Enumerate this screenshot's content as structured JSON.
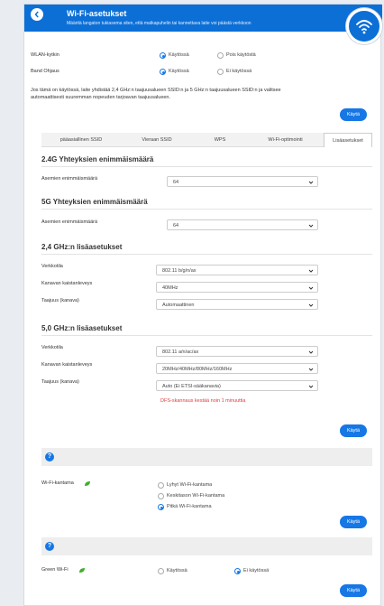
{
  "header": {
    "title": "Wi-Fi-asetukset",
    "subtitle": "Määritä langaton tukiasema siten, että matkapuhelin tai kannettava laite voi päästä verkkoon"
  },
  "wlan_switch": {
    "label": "WLAN-kytkin",
    "on": "Käytössä",
    "off": "Pois käytöstä"
  },
  "band_steering": {
    "label": "Band Ohjaus",
    "on": "Käytössä",
    "off": "Ei käytössä"
  },
  "description": [
    "Jos tämä on käytössä, laite yhdistää 2,4 GHz:n taajuusalueen SSID:n ja 5 GHz:n taajuusalueen SSID:n ja valitsee",
    "automaattisesti suuremman nopeuden tarjoavan taajuusalueen."
  ],
  "apply_label": "Käytä",
  "tabs": [
    "pääasiallinen SSID",
    "Vieraan SSID",
    "WPS",
    "Wi-Fi-optimointi",
    "Lisäasetukset"
  ],
  "max_24": {
    "title": "2.4G Yhteyksien enimmäismäärä",
    "label": "Asemien enimmäismäärä",
    "value": "64"
  },
  "max_5": {
    "title": "5G Yhteyksien enimmäismäärä",
    "label": "Asemien enimmäismäärä",
    "value": "64"
  },
  "adv_24": {
    "title": "2,4 GHz:n lisäasetukset",
    "mode_label": "Verkkotila",
    "mode_value": "802.11 b/g/n/ax",
    "bw_label": "Kanavan kaistanleveys",
    "bw_value": "40MHz",
    "ch_label": "Taajuus (kanava)",
    "ch_value": "Automaattinen"
  },
  "adv_5": {
    "title": "5,0 GHz:n lisäasetukset",
    "mode_label": "Verkkotila",
    "mode_value": "802.11 a/n/ac/ax",
    "bw_label": "Kanavan kaistanleveys",
    "bw_value": "20MHz/40MHz/80MHz/160MHz",
    "ch_label": "Taajuus (kanava)",
    "ch_value": "Auto (Ei ETSI-sääkanavia)",
    "dfs_note": "DFS-skannaus kestää noin 1 minuuttia"
  },
  "wifi_range": {
    "label": "Wi-Fi-kantama",
    "options": [
      "Lyhyt Wi-Fi-kantama",
      "Keskitason Wi-Fi-kantama",
      "Pitkä Wi-Fi-kantama"
    ],
    "selected": "Pitkä Wi-Fi-kantama"
  },
  "green_wifi": {
    "label": "Green Wi-Fi",
    "on": "Käytössä",
    "off": "Ei käytössä",
    "selected": "Ei käytössä"
  },
  "help_glyph": "?",
  "colors": {
    "accent": "#1677e5",
    "header": "#0c6fd6",
    "warning": "#e03b3b",
    "leaf": "#3fae2a"
  }
}
